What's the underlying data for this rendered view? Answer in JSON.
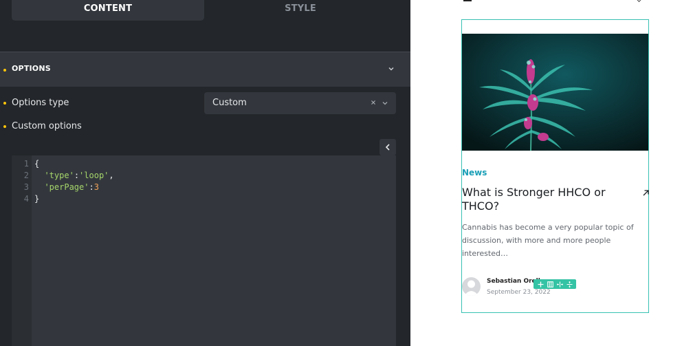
{
  "tabs": [
    {
      "label": "CONTENT",
      "active": true
    },
    {
      "label": "STYLE",
      "active": false
    }
  ],
  "options_section": {
    "title": "OPTIONS"
  },
  "controls": {
    "options_type": {
      "label": "Options type",
      "value": "Custom"
    },
    "custom_options": {
      "label": "Custom options"
    }
  },
  "code": {
    "line_numbers": [
      "1",
      "2",
      "3",
      "4"
    ],
    "lines": [
      {
        "text": "{"
      },
      {
        "indent": "  ",
        "key": "'type'",
        "sep": ":",
        "value": "'loop'",
        "end": ","
      },
      {
        "indent": "  ",
        "key": "'perPage'",
        "sep": ":",
        "value": "3",
        "end": ""
      },
      {
        "text": "}"
      }
    ]
  },
  "preview": {
    "card": {
      "category": "News",
      "title": "What is Stronger HHCO or THCO?",
      "excerpt": "Cannabis has become a very popular topic of discussion, with more and more people interested…",
      "author": "Sebastian Orell",
      "date": "September 23, 2022"
    },
    "toolbar_icons": [
      "move-icon",
      "columns-icon",
      "width-icon",
      "height-icon"
    ]
  },
  "colors": {
    "panel_bg": "#23262a",
    "control_bg": "#33373d",
    "accent_dot": "#ffc60a",
    "card_border": "#36c0b2",
    "category": "#1a9fb7",
    "toolbar": "#34c3a4"
  }
}
